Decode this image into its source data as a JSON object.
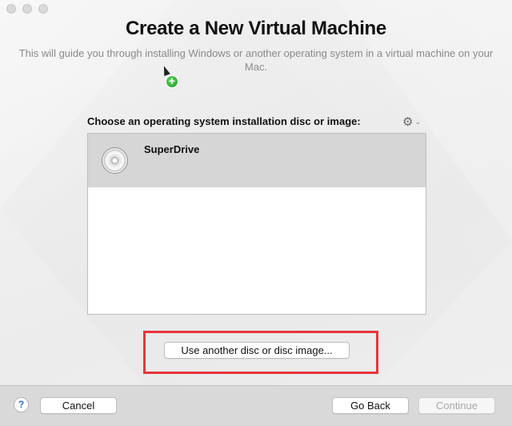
{
  "window": {
    "title": "Create a New Virtual Machine",
    "subtitle": "This will guide you through installing Windows or another operating system in a virtual machine on your Mac."
  },
  "list": {
    "label": "Choose an operating system installation disc or image:",
    "items": [
      {
        "label": "SuperDrive",
        "icon": "disc-icon",
        "selected": true
      }
    ]
  },
  "buttons": {
    "use_another": "Use another disc or disc image...",
    "help": "?",
    "cancel": "Cancel",
    "go_back": "Go Back",
    "continue": "Continue"
  },
  "icons": {
    "gear": "gear-icon",
    "chevron": "chevron-down-icon",
    "cursor": "cursor-icon",
    "add_badge": "plus-icon"
  },
  "colors": {
    "highlight": "#e8343c",
    "selection": "#d6d6d6"
  }
}
